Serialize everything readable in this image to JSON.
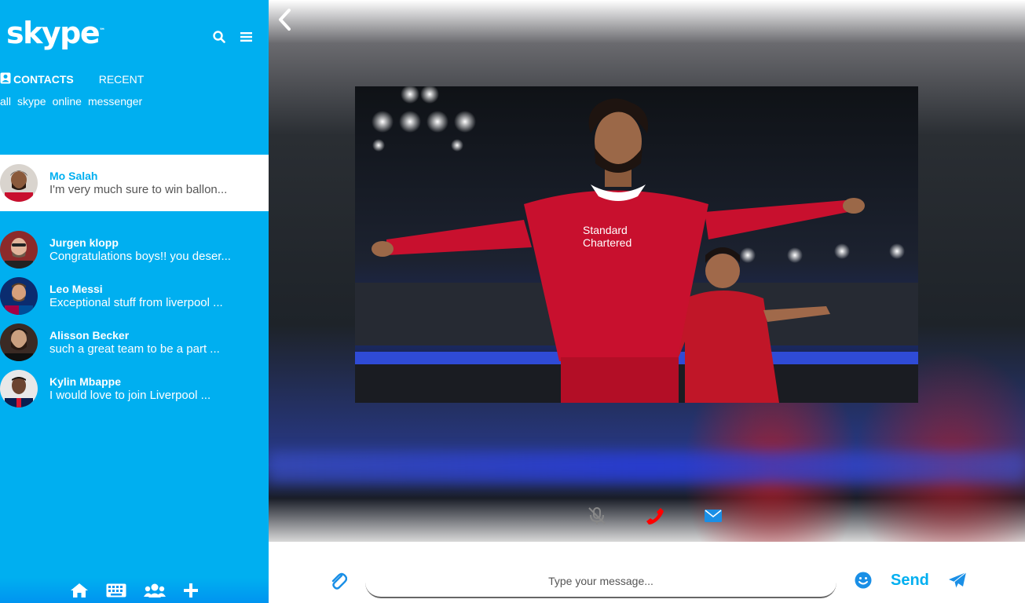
{
  "app": {
    "logo_text": "skype",
    "logo_tm": "™"
  },
  "header_icons": [
    "search-icon",
    "menu-icon"
  ],
  "tabs": [
    {
      "label": "CONTACTS",
      "active": true
    },
    {
      "label": "RECENT",
      "active": false
    }
  ],
  "filters": [
    "all",
    "skype",
    "online",
    "messenger"
  ],
  "contacts": [
    {
      "name": "Mo Salah",
      "message": "I'm very much sure to win ballon...",
      "selected": true
    },
    {
      "name": "Jurgen klopp",
      "message": "Congratulations boys!! you deser..."
    },
    {
      "name": "Leo Messi",
      "message": "Exceptional stuff from liverpool ..."
    },
    {
      "name": "Alisson Becker",
      "message": "such a great team to be a part ..."
    },
    {
      "name": "Kylin Mbappe",
      "message": "I would love to join Liverpool ..."
    }
  ],
  "bottom_nav": [
    "home-icon",
    "keyboard-icon",
    "group-icon",
    "plus-icon"
  ],
  "call_controls": [
    "mic-muted-icon",
    "phone-icon",
    "mail-icon"
  ],
  "composer": {
    "placeholder": "Type your message...",
    "send_label": "Send"
  },
  "colors": {
    "accent": "#00aff0",
    "call_red": "#ff0000",
    "mail_blue": "#1a8fe6"
  }
}
